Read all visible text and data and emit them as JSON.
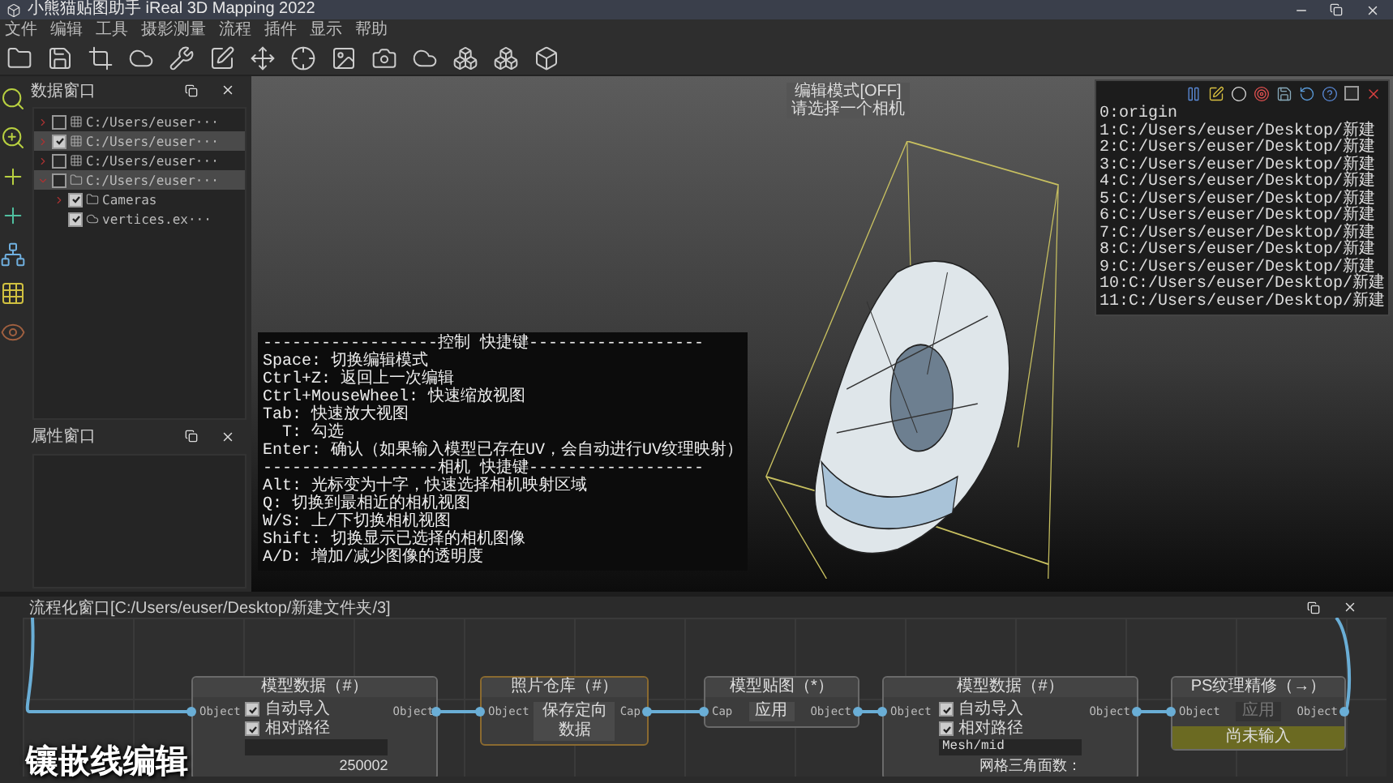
{
  "window": {
    "title": "小熊猫贴图助手 iReal 3D Mapping 2022"
  },
  "menu": [
    "文件",
    "编辑",
    "工具",
    "摄影测量",
    "流程",
    "插件",
    "显示",
    "帮助"
  ],
  "data_panel": {
    "title": "数据窗口",
    "tree": [
      {
        "label": "C:/Users/euser···",
        "kind": "model",
        "checked": false,
        "selected": false,
        "expanded": false
      },
      {
        "label": "C:/Users/euser···",
        "kind": "model",
        "checked": true,
        "selected": true,
        "expanded": false
      },
      {
        "label": "C:/Users/euser···",
        "kind": "model",
        "checked": false,
        "selected": false,
        "expanded": false
      },
      {
        "label": "C:/Users/euser···",
        "kind": "folder",
        "checked": false,
        "selected": true,
        "expanded": true,
        "children": [
          {
            "label": "Cameras",
            "kind": "folder",
            "checked": true,
            "selected": false,
            "expanded": false
          },
          {
            "label": "vertices.ex···",
            "kind": "cloud",
            "checked": true,
            "selected": false
          }
        ]
      }
    ]
  },
  "properties_panel": {
    "title": "属性窗口"
  },
  "viewport": {
    "mode_status": "编辑模式[OFF]",
    "hint": "请选择一个相机",
    "help": [
      "------------------控制 快捷键------------------",
      "Space: 切换编辑模式",
      "Ctrl+Z: 返回上一次编辑",
      "Ctrl+MouseWheel: 快速缩放视图",
      "Tab: 快速放大视图",
      "  T: 勾选",
      "Enter: 确认（如果输入模型已存在UV，会自动进行UV纹理映射）",
      "------------------相机 快捷键------------------",
      "Alt: 光标变为十字，快速选择相机映射区域",
      "Q: 切换到最相近的相机视图",
      "W/S: 上/下切换相机视图",
      "Shift: 切换显示已选择的相机图像",
      "A/D: 增加/减少图像的透明度"
    ]
  },
  "camera_list": {
    "entries": [
      "0:origin",
      "1:C:/Users/euser/Desktop/新建",
      "2:C:/Users/euser/Desktop/新建",
      "3:C:/Users/euser/Desktop/新建",
      "4:C:/Users/euser/Desktop/新建",
      "5:C:/Users/euser/Desktop/新建",
      "6:C:/Users/euser/Desktop/新建",
      "7:C:/Users/euser/Desktop/新建",
      "8:C:/Users/euser/Desktop/新建",
      "9:C:/Users/euser/Desktop/新建",
      "10:C:/Users/euser/Desktop/新建",
      "11:C:/Users/euser/Desktop/新建"
    ]
  },
  "flow_panel": {
    "title": "流程化窗口[C:/Users/euser/Desktop/新建文件夹/3]",
    "nodes": [
      {
        "title": "模型数据（#）",
        "selected": false,
        "input": "Object",
        "output": "Object",
        "rows": [
          {
            "kind": "checkbox",
            "label": "自动导入",
            "checked": true
          },
          {
            "kind": "checkbox",
            "label": "相对路径",
            "checked": true
          },
          {
            "kind": "field"
          },
          {
            "kind": "text",
            "text": "250002"
          }
        ]
      },
      {
        "title": "照片仓库（#）",
        "selected": true,
        "input": "Object",
        "output": "Cap",
        "rows": [
          {
            "kind": "button",
            "label": "保存定向数据",
            "disabled": false
          }
        ]
      },
      {
        "title": "模型贴图（*）",
        "selected": false,
        "input": "Cap",
        "output": "Object",
        "rows": [
          {
            "kind": "button",
            "label": "应用",
            "disabled": false
          }
        ]
      },
      {
        "title": "模型数据（#）",
        "selected": false,
        "input": "Object",
        "output": "Object",
        "rows": [
          {
            "kind": "checkbox",
            "label": "自动导入",
            "checked": true
          },
          {
            "kind": "checkbox",
            "label": "相对路径",
            "checked": true
          },
          {
            "kind": "field",
            "value": "Mesh/mid"
          },
          {
            "kind": "text",
            "text": "网格三角面数："
          }
        ]
      },
      {
        "title": "PS纹理精修（→）",
        "selected": false,
        "input": "Object",
        "output": "Object",
        "rows": [
          {
            "kind": "button",
            "label": "应用",
            "disabled": true
          }
        ],
        "footer": "尚未输入"
      }
    ]
  },
  "caption": "镶嵌线编辑"
}
